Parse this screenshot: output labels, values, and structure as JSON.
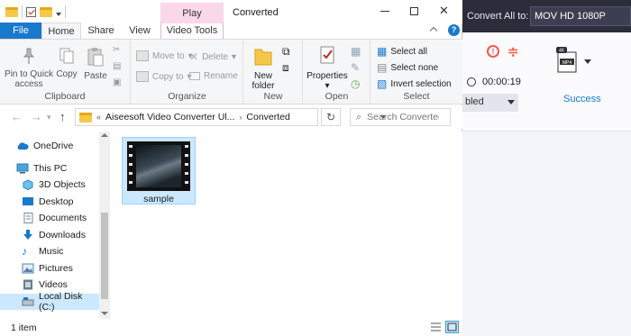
{
  "converter": {
    "convert_all_label": "Convert All to:",
    "format_value": "MOV HD 1080P",
    "duration": "00:00:19",
    "dropdown_value": "bled",
    "status": "Success",
    "badge_top": "4K",
    "badge_bottom": "MP4",
    "colors": {
      "accent": "#1478d4",
      "error": "#f05a4a",
      "header": "#2b2d3b"
    }
  },
  "window": {
    "title": "Converted",
    "context_tab_label": "Play"
  },
  "ribbon": {
    "tabs": [
      "File",
      "Home",
      "Share",
      "View",
      "Video Tools"
    ],
    "clipboard": {
      "label": "Clipboard",
      "pin_line1": "Pin to Quick",
      "pin_line2": "access",
      "copy": "Copy",
      "paste": "Paste"
    },
    "organize": {
      "label": "Organize",
      "move_to": "Move to",
      "copy_to": "Copy to",
      "delete": "Delete",
      "rename": "Rename"
    },
    "new": {
      "label": "New",
      "new_folder_line1": "New",
      "new_folder_line2": "folder"
    },
    "open": {
      "label": "Open",
      "properties": "Properties"
    },
    "select": {
      "label": "Select",
      "select_all": "Select all",
      "select_none": "Select none",
      "invert": "Invert selection"
    }
  },
  "address": {
    "prefix": "«",
    "segments": [
      "Aiseesoft Video Converter Ul...",
      "Converted"
    ],
    "search_placeholder": "Search Converted"
  },
  "nav": {
    "items": [
      {
        "label": "OneDrive",
        "icon": "cloud-icon"
      },
      {
        "label": "This PC",
        "icon": "computer-icon"
      },
      {
        "label": "3D Objects",
        "icon": "cube-icon"
      },
      {
        "label": "Desktop",
        "icon": "desktop-icon"
      },
      {
        "label": "Documents",
        "icon": "document-icon"
      },
      {
        "label": "Downloads",
        "icon": "download-icon"
      },
      {
        "label": "Music",
        "icon": "music-icon"
      },
      {
        "label": "Pictures",
        "icon": "picture-icon"
      },
      {
        "label": "Videos",
        "icon": "video-icon"
      },
      {
        "label": "Local Disk (C:)",
        "icon": "disk-icon"
      }
    ]
  },
  "content": {
    "files": [
      {
        "name": "sample",
        "type": "video"
      }
    ]
  },
  "status": {
    "item_count": "1 item"
  }
}
